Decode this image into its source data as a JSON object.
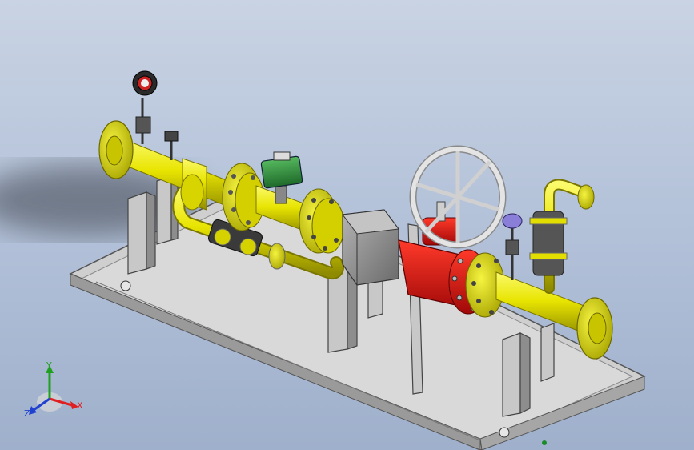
{
  "triad": {
    "x_label": "X",
    "y_label": "Y",
    "z_label": "Z"
  },
  "colors": {
    "background_top": "#c9d3e3",
    "background_bottom": "#9fb0cc",
    "pipe_yellow": "#e8e400",
    "pipe_yellow_dark": "#9e9a00",
    "valve_red": "#e01010",
    "actuator_green": "#2e8b3a",
    "frame_grey": "#c8c8c8",
    "frame_dark": "#6e6e6e",
    "box_grey": "#8c8c8c",
    "handwheel": "#dcdcdc",
    "axis_x": "#e02020",
    "axis_y": "#20a020",
    "axis_z": "#2040d0"
  }
}
